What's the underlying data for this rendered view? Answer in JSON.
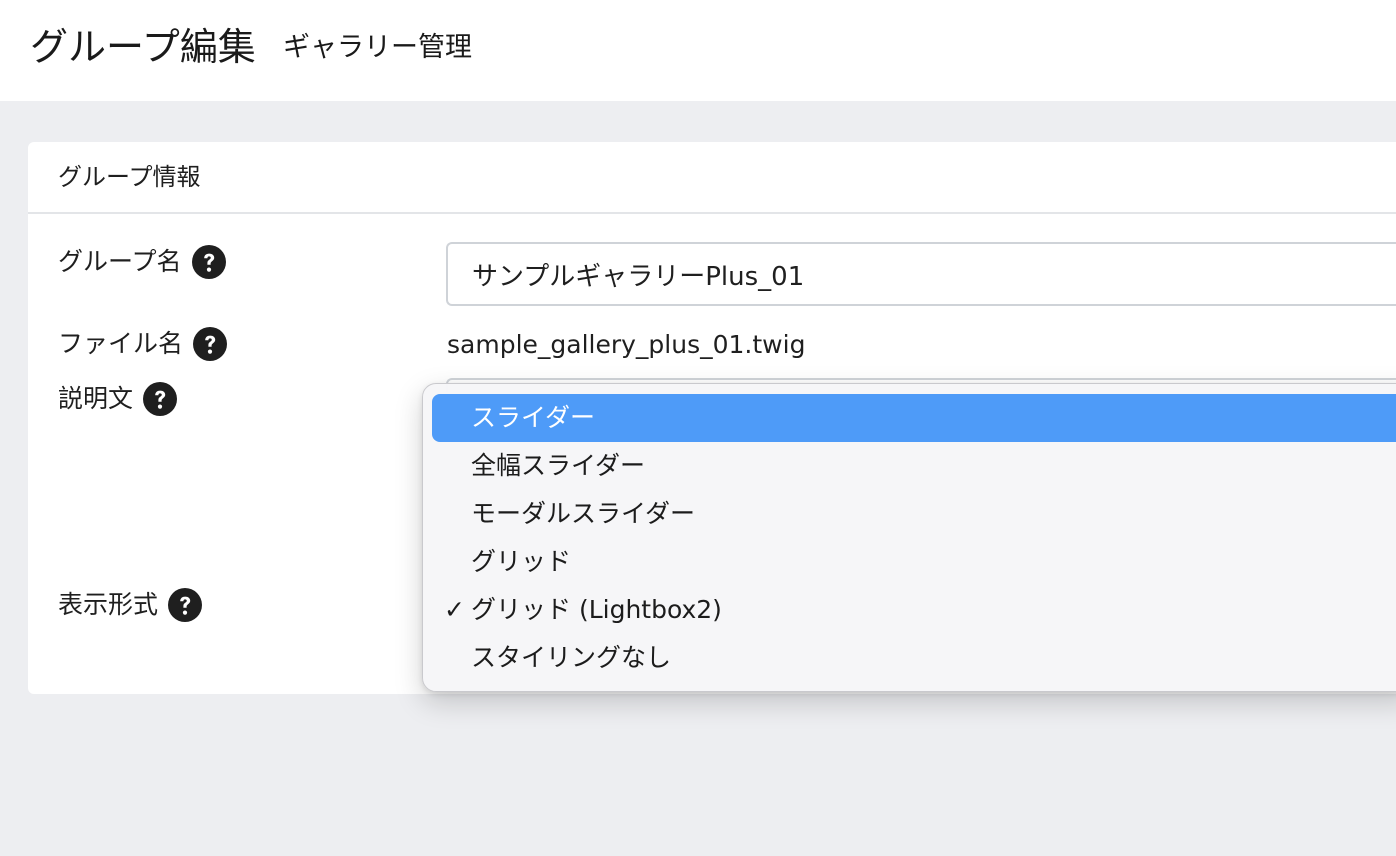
{
  "header": {
    "title": "グループ編集",
    "subtitle": "ギャラリー管理"
  },
  "card": {
    "title": "グループ情報"
  },
  "form": {
    "group_name": {
      "label": "グループ名",
      "value": "サンプルギャラリーPlus_01"
    },
    "file_name": {
      "label": "ファイル名",
      "value": "sample_gallery_plus_01.twig"
    },
    "description": {
      "label": "説明文"
    },
    "display_format": {
      "label": "表示形式",
      "selected": "グリッド (Lightbox2)",
      "highlighted": "スライダー",
      "options": [
        {
          "label": "スライダー",
          "checked": false,
          "highlighted": true
        },
        {
          "label": "全幅スライダー",
          "checked": false,
          "highlighted": false
        },
        {
          "label": "モーダルスライダー",
          "checked": false,
          "highlighted": false
        },
        {
          "label": "グリッド",
          "checked": false,
          "highlighted": false
        },
        {
          "label": "グリッド (Lightbox2)",
          "checked": true,
          "highlighted": false
        },
        {
          "label": "スタイリングなし",
          "checked": false,
          "highlighted": false
        }
      ]
    }
  },
  "icons": {
    "help": "question-circle-icon",
    "check": "checkmark-icon"
  },
  "colors": {
    "highlight": "#4e9bf8",
    "page_background": "#edeef1"
  }
}
